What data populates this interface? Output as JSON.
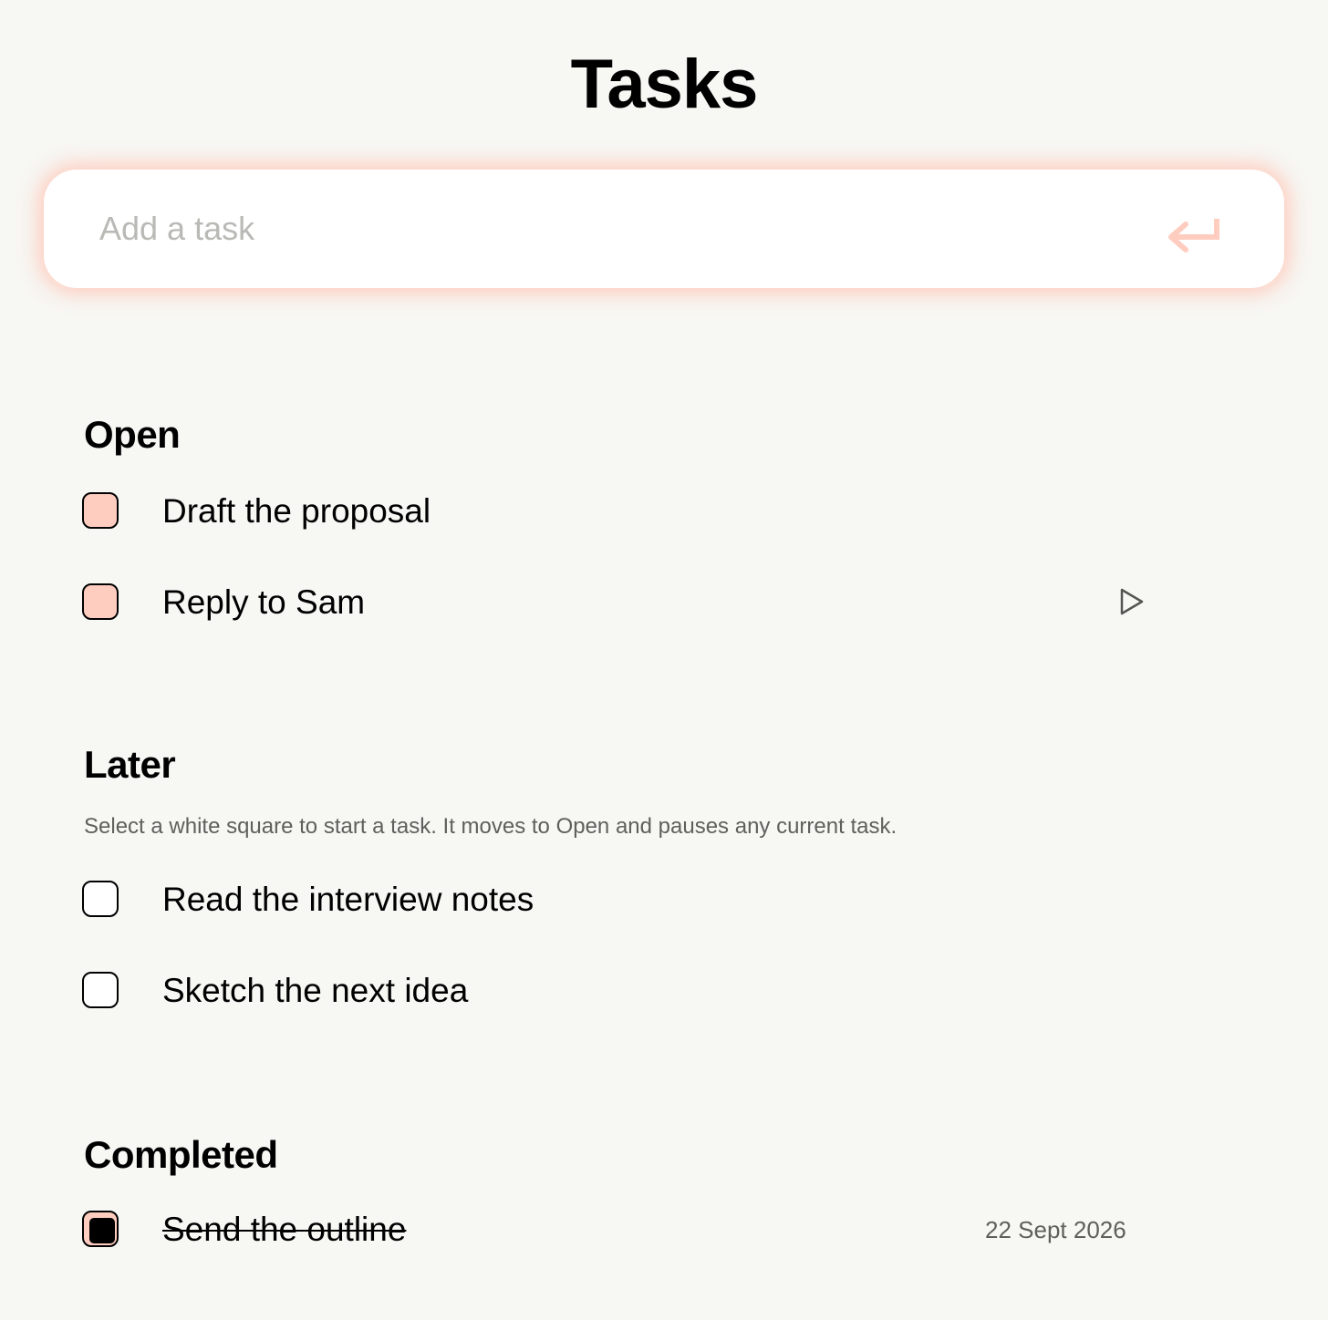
{
  "header": {
    "title": "Tasks"
  },
  "add_task": {
    "placeholder": "Add a task",
    "value": "",
    "submit_icon": "return-arrow-icon"
  },
  "sections": {
    "open": {
      "heading": "Open",
      "tasks": [
        {
          "label": "Draft the proposal",
          "state": "open"
        },
        {
          "label": "Reply to Sam",
          "state": "open",
          "action_icon": "play-icon"
        }
      ]
    },
    "later": {
      "heading": "Later",
      "help": "Select a white square to start a task. It moves to Open and pauses any current task.",
      "tasks": [
        {
          "label": "Read the interview notes",
          "state": "later"
        },
        {
          "label": "Sketch the next idea",
          "state": "later"
        }
      ]
    },
    "completed": {
      "heading": "Completed",
      "tasks": [
        {
          "label": "Send the outline",
          "state": "done",
          "date": "22 Sept 2026"
        }
      ]
    }
  },
  "colors": {
    "background": "#f7f7f4",
    "accent": "#ffcdbf",
    "glow": "#ffc4b4",
    "muted_text": "#5f5f5c"
  }
}
